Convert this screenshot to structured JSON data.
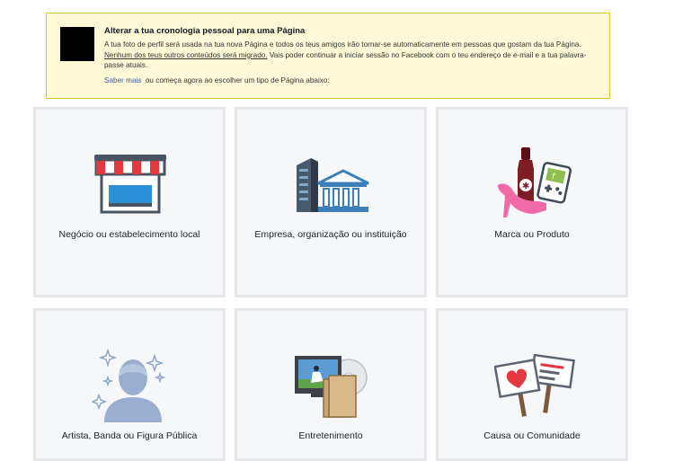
{
  "notice": {
    "title": "Alterar a tua cronologia pessoal para uma Página",
    "text_1": "A tua foto de perfil será usada na tua nova Página e todos os teus amigos irão tornar-se automaticamente em pessoas que gostam da tua Página.",
    "text_underlined": "Nenhum dos teus outros conteúdos será migrado.",
    "text_2": "Vais poder continuar a iniciar sessão no Facebook com o teu endereço de e-mail e a tua palavra-passe atuais.",
    "link": "Saber mais",
    "text_3": "ou começa agora ao escolher um tipo de Página abaixo:"
  },
  "categories": [
    {
      "label": "Negócio ou estabelecimento local",
      "icon": "storefront-icon"
    },
    {
      "label": "Empresa, organização ou instituição",
      "icon": "building-icon"
    },
    {
      "label": "Marca ou Produto",
      "icon": "products-icon"
    },
    {
      "label": "Artista, Banda ou Figura Pública",
      "icon": "artist-silhouette-icon"
    },
    {
      "label": "Entretenimento",
      "icon": "entertainment-icon"
    },
    {
      "label": "Causa ou Comunidade",
      "icon": "protest-signs-icon"
    }
  ]
}
